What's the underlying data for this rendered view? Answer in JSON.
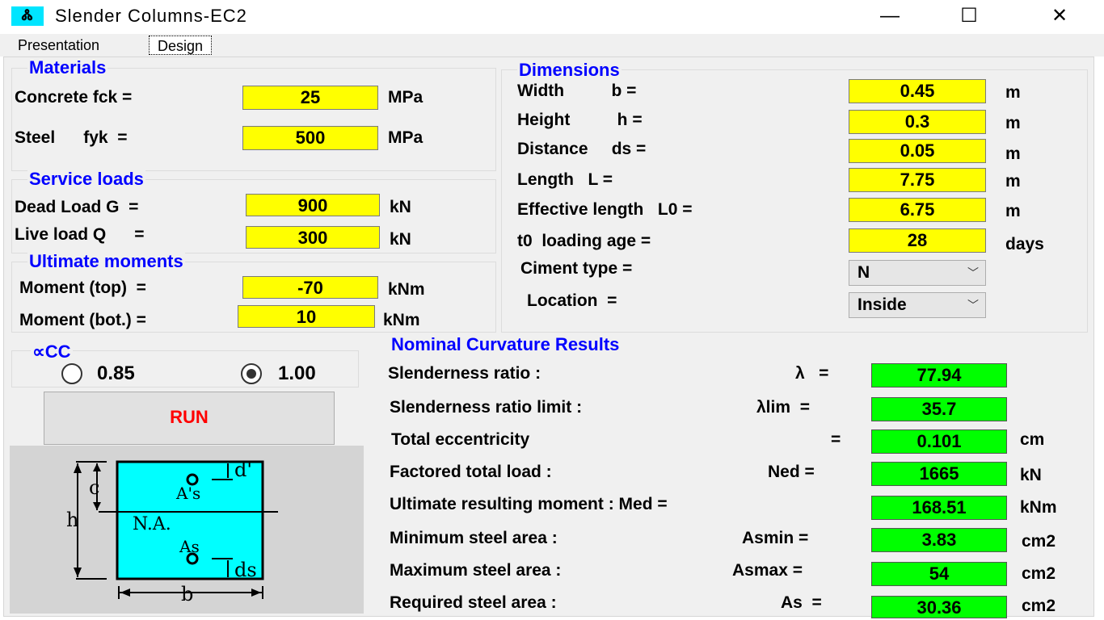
{
  "window": {
    "title": "Slender Columns-EC2",
    "icon_glyph": "Ꮬ",
    "minimize": "—",
    "maximize": "☐",
    "close": "✕"
  },
  "tabs": [
    {
      "label": "Presentation",
      "active": false
    },
    {
      "label": "Design",
      "active": true
    }
  ],
  "materials": {
    "title": "Materials",
    "concrete_label": "Concrete fck =",
    "concrete_value": "25",
    "concrete_unit": "MPa",
    "steel_label": "Steel      fyk  =",
    "steel_value": "500",
    "steel_unit": "MPa"
  },
  "service_loads": {
    "title": "Service loads",
    "dead_label": "Dead Load G  =",
    "dead_value": "900",
    "dead_unit": "kN",
    "live_label": "Live load Q      =",
    "live_value": "300",
    "live_unit": "kN"
  },
  "ultimate_moments": {
    "title": "Ultimate moments",
    "top_label": "Moment (top)  =",
    "top_value": "-70",
    "top_unit": "kNm",
    "bot_label": "Moment (bot.) =",
    "bot_value": "10",
    "bot_unit": "kNm"
  },
  "alpha_cc": {
    "title": "∝CC",
    "options": [
      {
        "label": "0.85",
        "selected": false
      },
      {
        "label": "1.00",
        "selected": true
      }
    ]
  },
  "run_button": {
    "label": "RUN"
  },
  "dimensions": {
    "title": "Dimensions",
    "rows": [
      {
        "label": "Width          b =",
        "value": "0.45",
        "unit": "m"
      },
      {
        "label": "Height          h =",
        "value": "0.3",
        "unit": "m"
      },
      {
        "label": "Distance     ds =",
        "value": "0.05",
        "unit": "m"
      },
      {
        "label": "Length   L =",
        "value": "7.75",
        "unit": "m"
      },
      {
        "label": "Effective length   L0 =",
        "value": "6.75",
        "unit": "m"
      },
      {
        "label": "t0  loading age =",
        "value": "28",
        "unit": "days"
      }
    ],
    "ciment_label": "Ciment type =",
    "ciment_value": "N",
    "location_label": "Location  =",
    "location_value": "Inside"
  },
  "results": {
    "title": "Nominal Curvature Results",
    "rows": [
      {
        "label": "Slenderness ratio :",
        "symbol": "λ   =",
        "value": "77.94",
        "unit": ""
      },
      {
        "label": "Slenderness ratio limit :",
        "symbol": "λlim  =",
        "value": "35.7",
        "unit": ""
      },
      {
        "label": "Total eccentricity",
        "symbol": "=",
        "value": "0.101",
        "unit": "cm"
      },
      {
        "label": "Factored total load :",
        "symbol": "Ned =",
        "value": "1665",
        "unit": "kN"
      },
      {
        "label": "Ultimate resulting moment : Med =",
        "symbol": "",
        "value": "168.51",
        "unit": "kNm"
      },
      {
        "label": "Minimum steel area :",
        "symbol": "Asmin =",
        "value": "3.83",
        "unit": "cm2"
      },
      {
        "label": "Maximum steel area :",
        "symbol": "Asmax =",
        "value": "54",
        "unit": "cm2"
      },
      {
        "label": "Required steel area :",
        "symbol": "As  =",
        "value": "30.36",
        "unit": "cm2"
      }
    ]
  },
  "diagram": {
    "c": "c",
    "h": "h",
    "d_prime": "d'",
    "as_prime": "A's",
    "na": "N.A.",
    "as": "As",
    "ds": "ds",
    "b": "b",
    "fill_color": "#00ffff"
  }
}
